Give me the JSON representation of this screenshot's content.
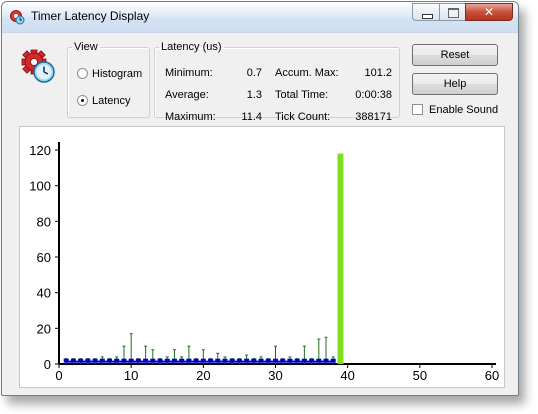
{
  "window": {
    "title": "Timer Latency Display"
  },
  "view": {
    "legend": "View",
    "options": [
      {
        "label": "Histogram",
        "selected": false
      },
      {
        "label": "Latency",
        "selected": true
      }
    ]
  },
  "latency": {
    "legend": "Latency (us)",
    "minimum_label": "Minimum:",
    "minimum_value": "0.7",
    "average_label": "Average:",
    "average_value": "1.3",
    "maximum_label": "Maximum:",
    "maximum_value": "11.4",
    "accum_max_label": "Accum. Max:",
    "accum_max_value": "101.2",
    "total_time_label": "Total Time:",
    "total_time_value": "0:00:38",
    "tick_count_label": "Tick Count:",
    "tick_count_value": "388171"
  },
  "buttons": {
    "reset": "Reset",
    "help": "Help"
  },
  "sound": {
    "label": "Enable Sound",
    "checked": false
  },
  "icons": {
    "app": "timer-gear-icon",
    "main": "gear-clock-icon"
  },
  "colors": {
    "max_stem": "#1f6e1f",
    "avg_marker": "#0000cc",
    "current_bar": "#80e020"
  },
  "chart_data": {
    "type": "bar",
    "title": "",
    "xlabel": "",
    "ylabel": "",
    "xlim": [
      0,
      60
    ],
    "ylim": [
      0,
      120
    ],
    "x_ticks": [
      0,
      10,
      20,
      30,
      40,
      50,
      60
    ],
    "y_ticks": [
      0,
      20,
      40,
      60,
      80,
      100,
      120
    ],
    "grid": false,
    "series": [
      {
        "x": [
          1,
          2,
          3,
          4,
          5,
          6,
          7,
          8,
          9,
          10,
          11,
          12,
          13,
          14,
          15,
          16,
          17,
          18,
          19,
          20,
          21,
          22,
          23,
          24,
          25,
          26,
          27,
          28,
          29,
          30,
          31,
          32,
          33,
          34,
          35,
          36,
          37,
          38
        ],
        "values": [
          3,
          3,
          3,
          3,
          3,
          4,
          3,
          4,
          10,
          17,
          3,
          10,
          8,
          3,
          4,
          8,
          4,
          10,
          3,
          8,
          3,
          6,
          4,
          3,
          3,
          5,
          3,
          4,
          3,
          10,
          3,
          4,
          3,
          10,
          3,
          14,
          15,
          4
        ]
      },
      {
        "x": [
          1,
          2,
          3,
          4,
          5,
          6,
          7,
          8,
          9,
          10,
          11,
          12,
          13,
          14,
          15,
          16,
          17,
          18,
          19,
          20,
          21,
          22,
          23,
          24,
          25,
          26,
          27,
          28,
          29,
          30,
          31,
          32,
          33,
          34,
          35,
          36,
          37,
          38
        ],
        "values": [
          1.3,
          1.3,
          1.3,
          1.3,
          1.3,
          1.3,
          1.3,
          1.3,
          1.3,
          1.3,
          1.3,
          1.3,
          1.3,
          1.3,
          1.3,
          1.3,
          1.3,
          1.3,
          1.3,
          1.3,
          1.3,
          1.3,
          1.3,
          1.3,
          1.3,
          1.3,
          1.3,
          1.3,
          1.3,
          1.3,
          1.3,
          1.3,
          1.3,
          1.3,
          1.3,
          1.3,
          1.3,
          1.3
        ]
      },
      {
        "x": [
          39
        ],
        "values": [
          118
        ]
      }
    ]
  }
}
